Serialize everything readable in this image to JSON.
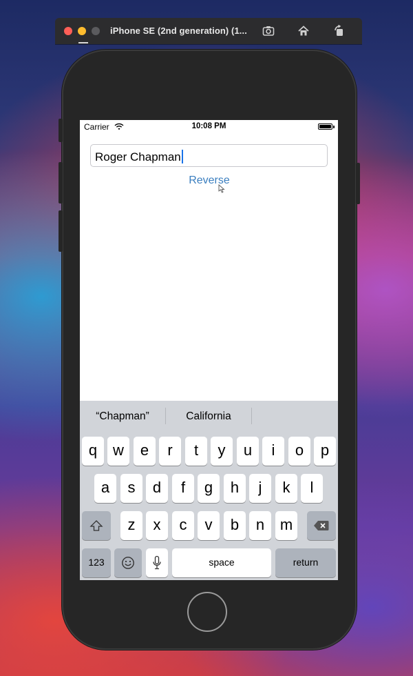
{
  "window": {
    "title": "iPhone SE (2nd generation) (1...",
    "icons": [
      "screenshot-icon",
      "home-icon",
      "rotate-icon"
    ]
  },
  "status_bar": {
    "carrier": "Carrier",
    "time": "10:08 PM",
    "icons": [
      "wifi-icon",
      "battery-icon"
    ]
  },
  "app": {
    "text_field_value": "Roger Chapman",
    "reverse_button": "Reverse",
    "accent_color": "#3a7ebf"
  },
  "keyboard": {
    "suggestions": [
      "“Chapman”",
      "California",
      ""
    ],
    "rows": [
      [
        "q",
        "w",
        "e",
        "r",
        "t",
        "y",
        "u",
        "i",
        "o",
        "p"
      ],
      [
        "a",
        "s",
        "d",
        "f",
        "g",
        "h",
        "j",
        "k",
        "l"
      ],
      [
        "z",
        "x",
        "c",
        "v",
        "b",
        "n",
        "m"
      ]
    ],
    "numbers_key": "123",
    "space_key": "space",
    "return_key": "return",
    "special_icons": [
      "shift-icon",
      "delete-icon",
      "emoji-icon",
      "microphone-icon"
    ]
  }
}
